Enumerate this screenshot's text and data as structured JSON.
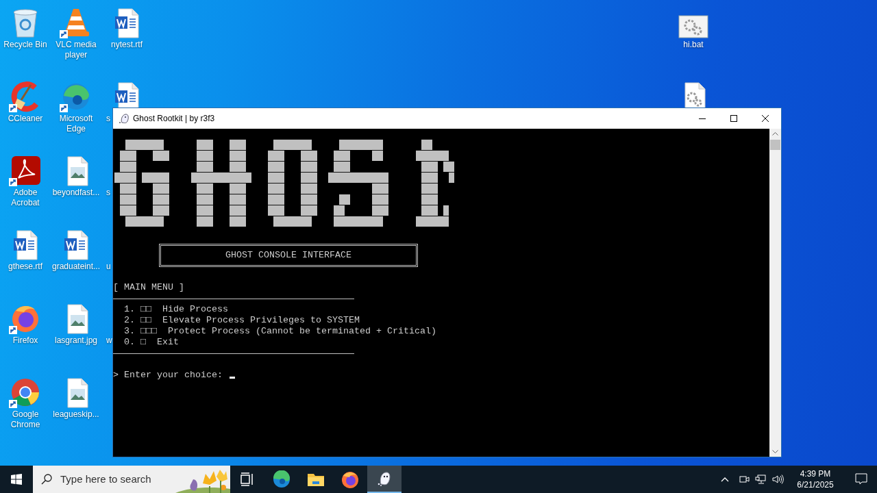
{
  "desktop": {
    "columns": [
      [
        {
          "label": "Recycle Bin",
          "kind": "recycle"
        },
        {
          "label": "CCleaner",
          "kind": "ccleaner",
          "shortcut": true
        },
        {
          "label": "Adobe Acrobat",
          "kind": "acrobat",
          "shortcut": true
        },
        {
          "label": "gthese.rtf",
          "kind": "word"
        },
        {
          "label": "Firefox",
          "kind": "firefox",
          "shortcut": true
        },
        {
          "label": "Google Chrome",
          "kind": "chrome",
          "shortcut": true
        }
      ],
      [
        {
          "label": "VLC media player",
          "kind": "vlc",
          "shortcut": true
        },
        {
          "label": "Microsoft Edge",
          "kind": "edge",
          "shortcut": true
        },
        {
          "label": "beyondfast...",
          "kind": "image"
        },
        {
          "label": "graduateint...",
          "kind": "word"
        },
        {
          "label": "lasgrant.jpg",
          "kind": "image"
        },
        {
          "label": "leagueskip...",
          "kind": "image"
        }
      ],
      [
        {
          "label": "nytest.rtf",
          "kind": "word"
        },
        {
          "label": "s",
          "kind": "word"
        },
        {
          "label": "s"
        },
        {
          "label": "u"
        },
        {
          "label": "w"
        }
      ]
    ],
    "right_icons": [
      {
        "label": "hi.bat",
        "kind": "bat"
      },
      {
        "kind": "batdoc"
      }
    ]
  },
  "window": {
    "title": "Ghost Rootkit | by r3f3"
  },
  "console": {
    "banner": [
      "  ███████      ███   ███     ███████     ████████       ██     ",
      " ███   ███     ███   ███    ███   ███   ███    ██      ██████  ",
      " ███           ███   ███    ███   ███   ███             ███ ██ ",
      "████ █████    ███████████   ███   ███  ███████████      ███  █ ",
      " ███   ███     ███   ███    ███   ███          ███      ███    ",
      " ███   ███     ███   ███    ███   ███    ██    ███      ███    ",
      " ███   ███     ███   ███    ███   ███   ██     ███      ███ █  ",
      "  ███████      ███   ███     ███████    █████████      ██████  "
    ],
    "header_box": "GHOST CONSOLE INTERFACE",
    "menu_title": "[ MAIN MENU ]",
    "menu_items": [
      "1. □□  Hide Process",
      "2. □□  Elevate Process Privileges to SYSTEM",
      "3. □□□  Protect Process (Cannot be terminated + Critical)",
      "0. □  Exit"
    ],
    "prompt": "> Enter your choice:"
  },
  "taskbar": {
    "search_placeholder": "Type here to search",
    "apps": [
      {
        "kind": "taskview",
        "active": false
      },
      {
        "kind": "edge",
        "active": false
      },
      {
        "kind": "explorer",
        "active": false
      },
      {
        "kind": "firefox",
        "active": false
      },
      {
        "kind": "ghost",
        "active": true
      }
    ],
    "clock": {
      "time": "4:39 PM",
      "date": "6/21/2025"
    }
  }
}
